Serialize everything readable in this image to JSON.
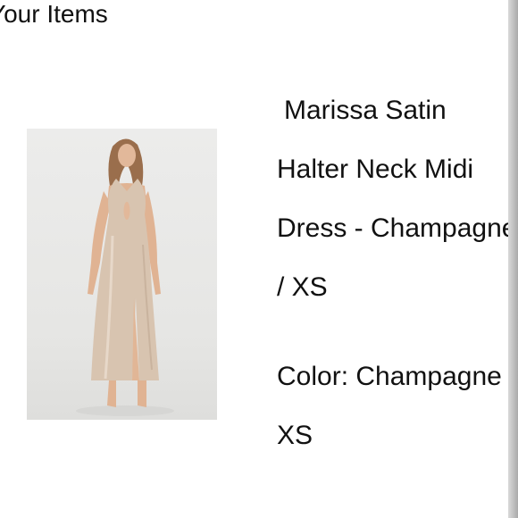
{
  "section": {
    "title": "Your Items"
  },
  "item": {
    "name_lines": [
      "Marissa Satin",
      "Halter Neck Midi",
      "Dress - Champagne",
      "/ XS"
    ],
    "color_text": "Color: Champagne",
    "size_text": "XS",
    "image_alt": "Model wearing champagne satin halter neck midi dress"
  },
  "colors": {
    "dress": "#d9c6b3",
    "background": "#ffffff"
  }
}
